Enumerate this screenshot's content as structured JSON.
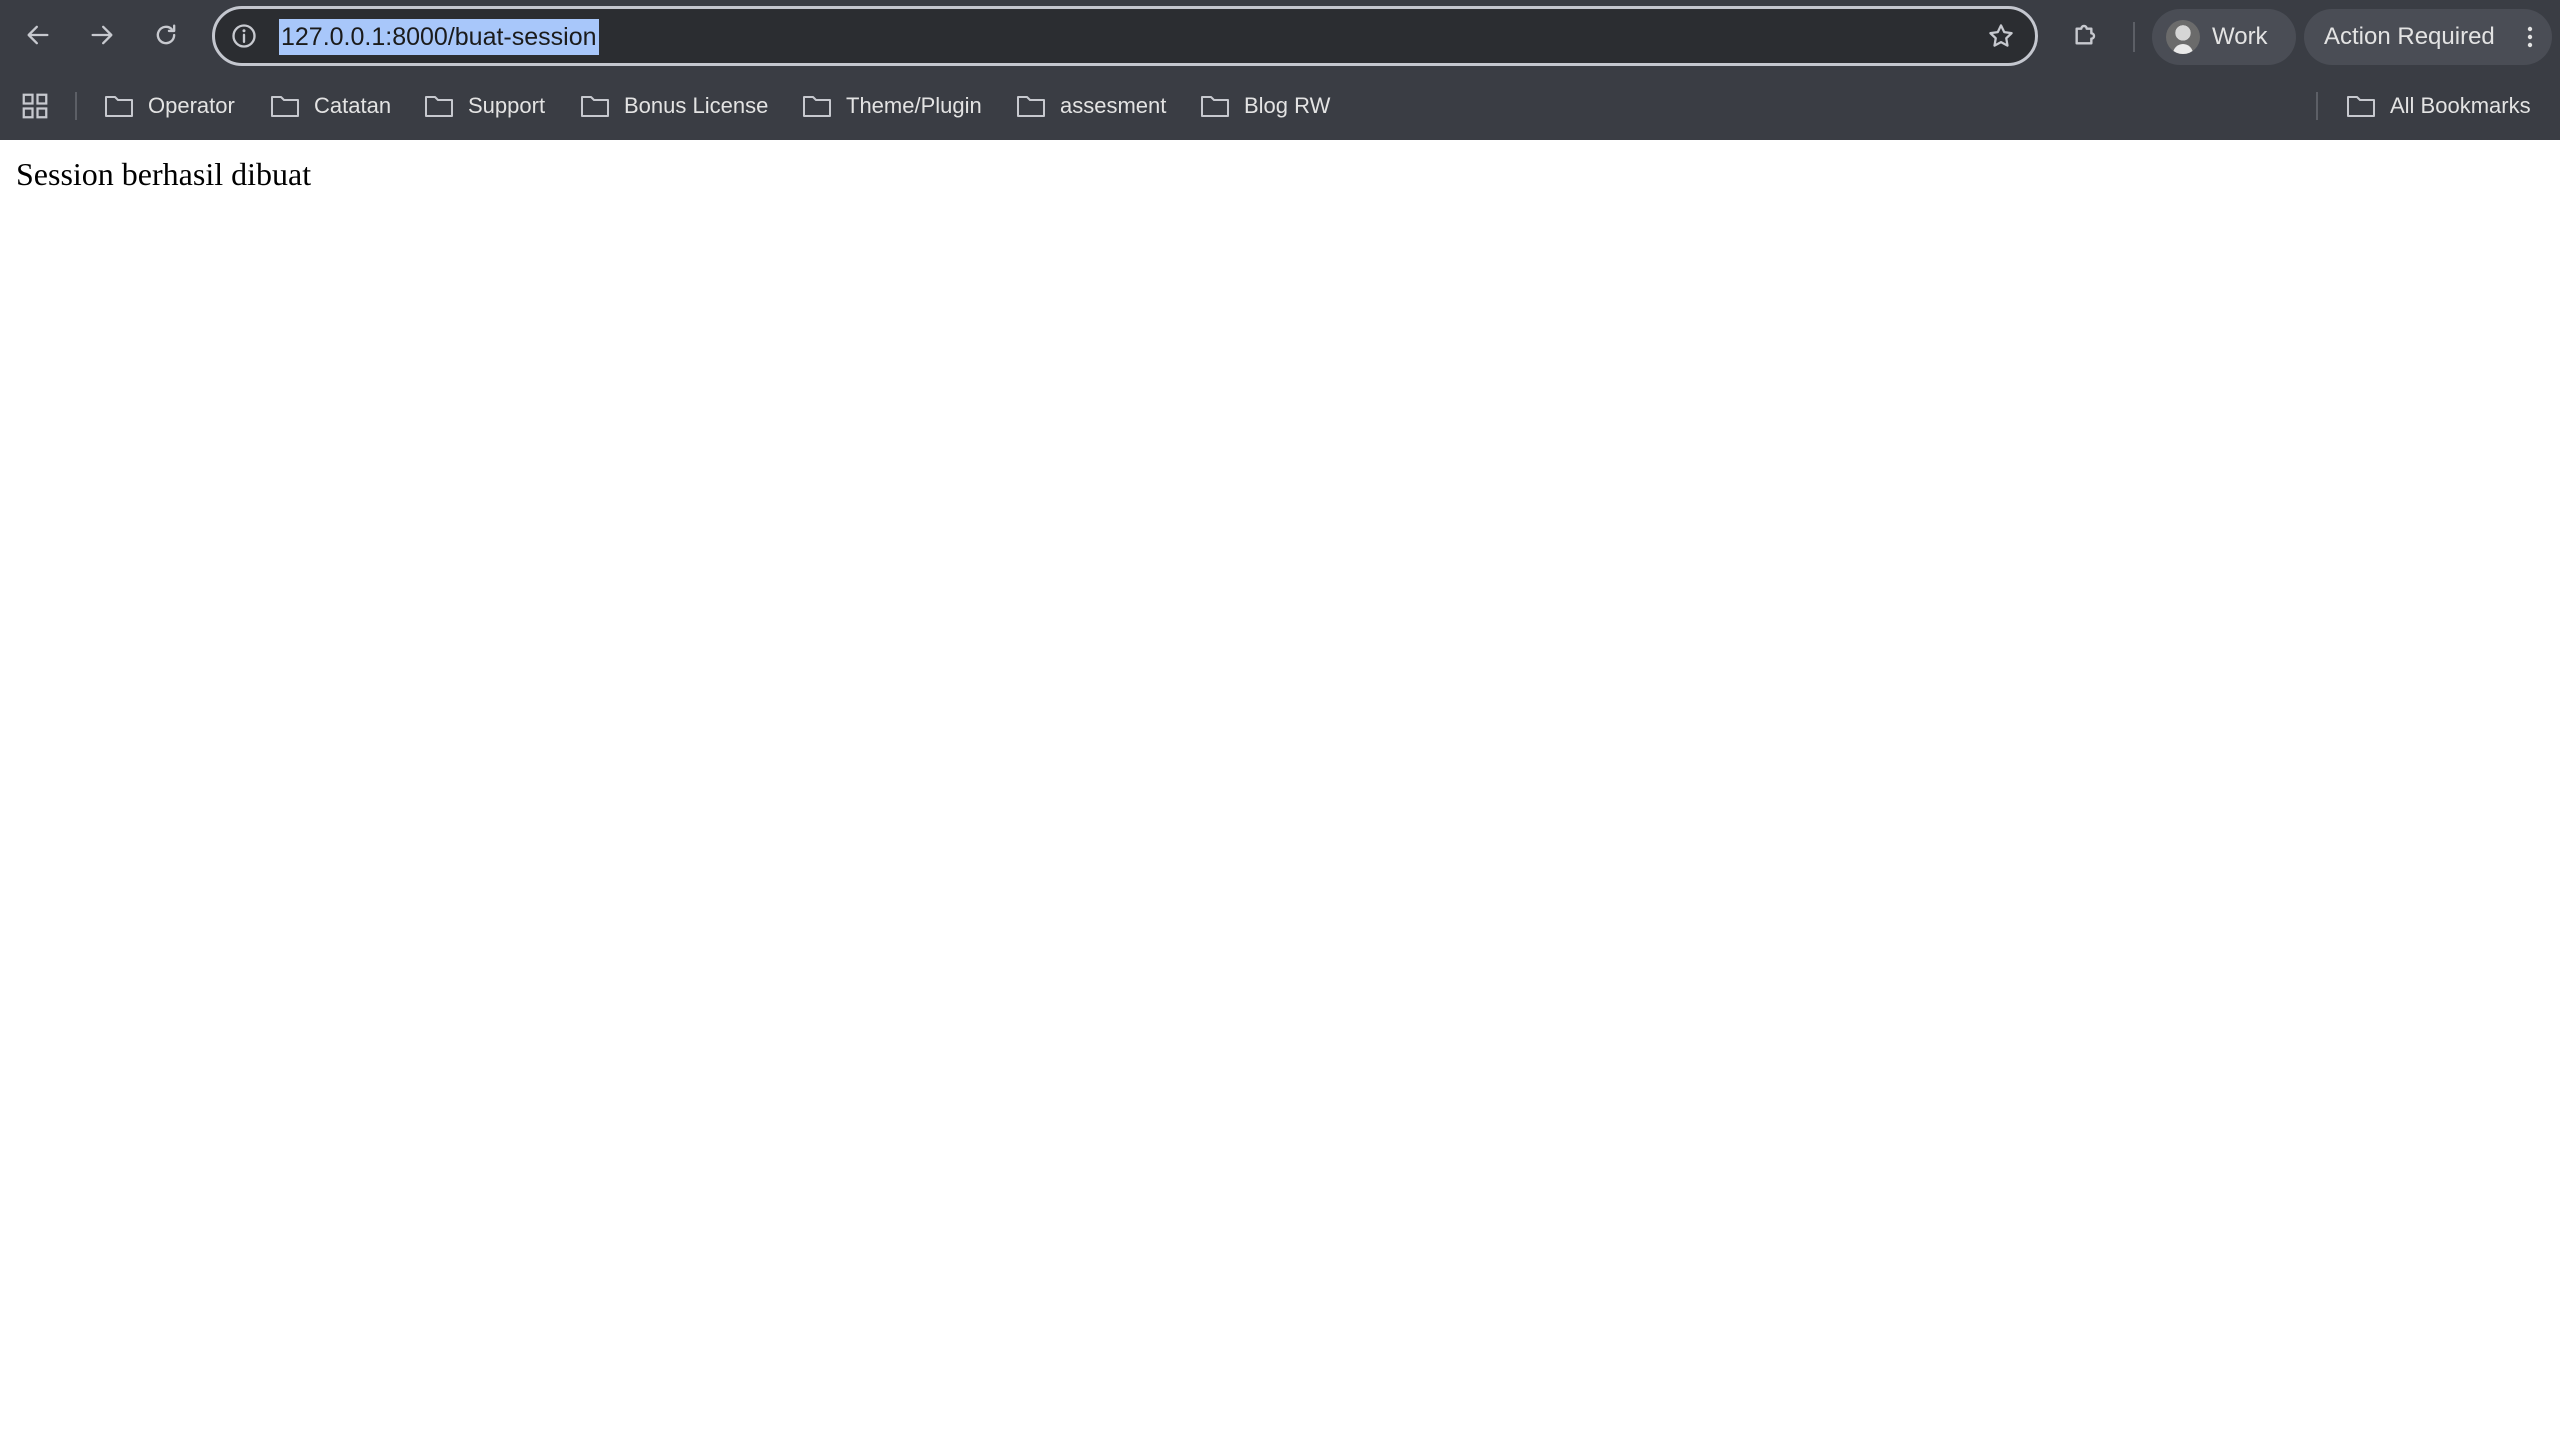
{
  "browser": {
    "url": "127.0.0.1:8000/buat-session",
    "profile_label": "Work",
    "action_label": "Action Required",
    "icons": {
      "back": "back-arrow-icon",
      "forward": "forward-arrow-icon",
      "reload": "reload-icon",
      "site_info": "info-icon",
      "bookmark_star": "star-icon",
      "extensions": "puzzle-icon",
      "menu": "kebab-menu-icon",
      "apps": "apps-grid-icon",
      "folder": "folder-icon"
    },
    "colors": {
      "chrome_bg": "#3a3d44",
      "url_highlight": "#a8c7fa",
      "chip_bg": "#4a4d55"
    }
  },
  "bookmarks": {
    "items": [
      {
        "label": "Operator"
      },
      {
        "label": "Catatan"
      },
      {
        "label": "Support"
      },
      {
        "label": "Bonus License"
      },
      {
        "label": "Theme/Plugin"
      },
      {
        "label": "assesment"
      },
      {
        "label": "Blog RW"
      }
    ],
    "all_label": "All Bookmarks"
  },
  "page": {
    "message": "Session berhasil dibuat"
  }
}
